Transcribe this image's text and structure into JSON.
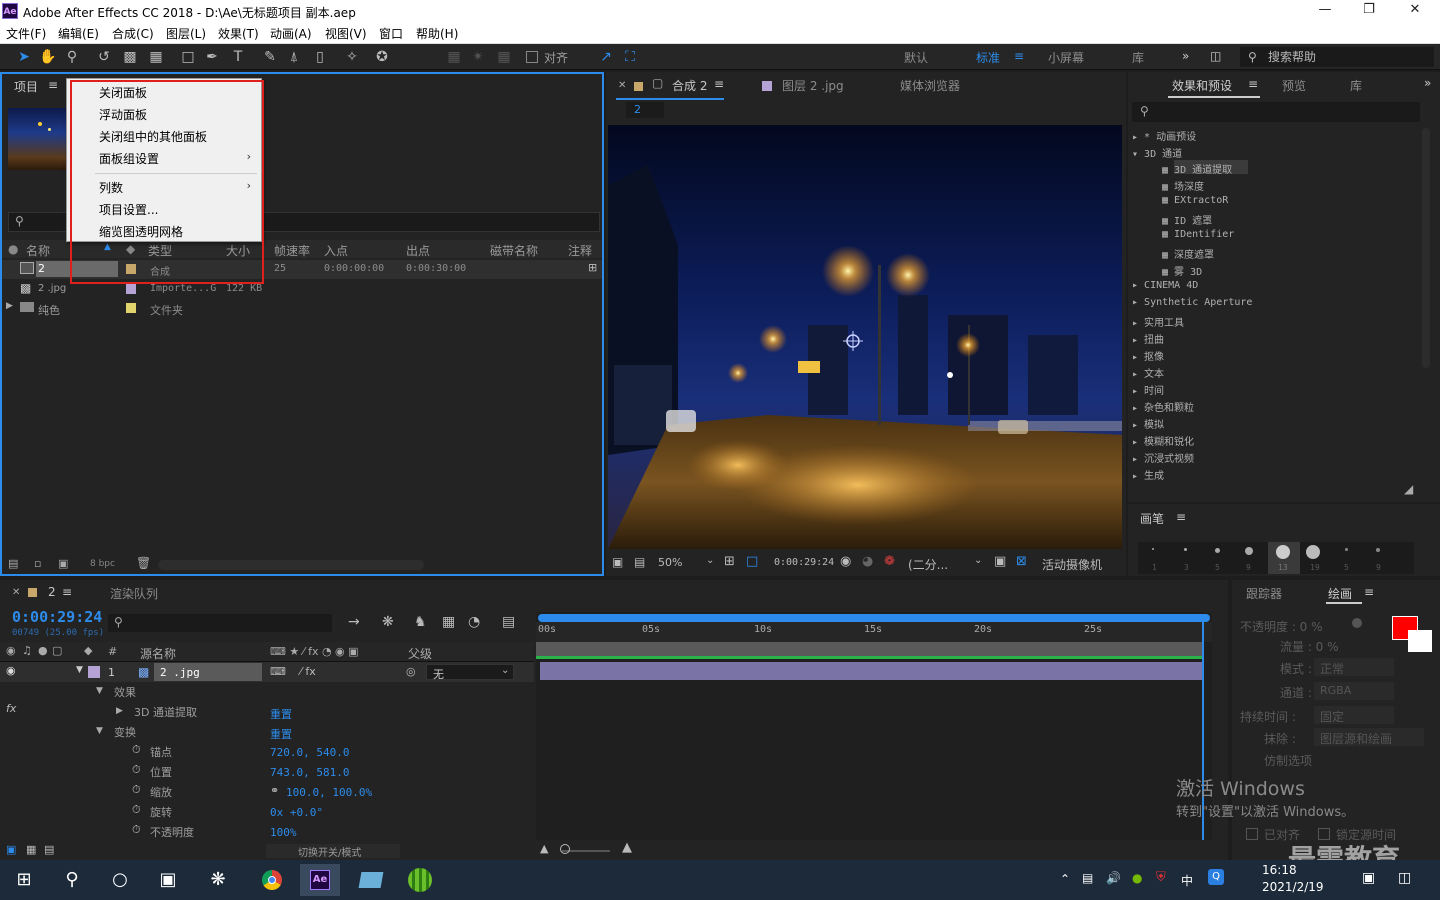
{
  "window": {
    "title": "Adobe After Effects CC 2018 - D:\\Ae\\无标题项目 副本.aep",
    "logo": "Ae"
  },
  "menubar": [
    "文件(F)",
    "编辑(E)",
    "合成(C)",
    "图层(L)",
    "效果(T)",
    "动画(A)",
    "视图(V)",
    "窗口",
    "帮助(H)"
  ],
  "toolbar": {
    "snap_label": "对齐",
    "workspaces": [
      "默认",
      "标准",
      "小屏幕",
      "库"
    ],
    "active_workspace": "标准",
    "search_placeholder": "搜索帮助"
  },
  "project_panel": {
    "tab": "项目",
    "columns": [
      "名称",
      "类型",
      "大小",
      "帧速率",
      "入点",
      "出点",
      "磁带名称",
      "注释"
    ],
    "rows": [
      {
        "name": "2",
        "type": "合成",
        "size": "",
        "fps": "25",
        "in": "0:00:00:00",
        "out": "0:00:30:00"
      },
      {
        "name": "2 .jpg",
        "type": "Importe...G",
        "size": "122 KB",
        "fps": "",
        "in": "",
        "out": ""
      },
      {
        "name": "纯色",
        "type": "文件夹",
        "size": "",
        "fps": "",
        "in": "",
        "out": ""
      }
    ],
    "bpc": "8 bpc"
  },
  "context_menu": {
    "items": [
      "关闭面板",
      "浮动面板",
      "关闭组中的其他面板",
      "面板组设置",
      "列数",
      "项目设置...",
      "缩览图透明网格"
    ],
    "submenu_arrow": "›"
  },
  "comp_panel": {
    "tabs": [
      "合成 2",
      "图层 2 .jpg",
      "媒体浏览器"
    ],
    "comp_name": "2",
    "zoom": "50%",
    "timecode": "0:00:29:24",
    "resolution": "(二分...",
    "camera": "活动摄像机"
  },
  "effects_panel": {
    "tabs": [
      "效果和预设",
      "预览",
      "库"
    ],
    "categories_top": [
      "* 动画预设",
      "3D 通道"
    ],
    "sub_items": [
      "3D 通道提取",
      "场深度",
      "EXtractoR",
      "ID 遮罩",
      "IDentifier",
      "深度遮罩",
      "雾 3D"
    ],
    "categories": [
      "CINEMA 4D",
      "Synthetic Aperture",
      "实用工具",
      "扭曲",
      "抠像",
      "文本",
      "时间",
      "杂色和颗粒",
      "模拟",
      "模糊和锐化",
      "沉浸式视频",
      "生成"
    ]
  },
  "brushes_panel": {
    "tab": "画笔",
    "sizes": [
      "1",
      "3",
      "5",
      "9",
      "13",
      "19",
      "5",
      "9"
    ]
  },
  "timeline": {
    "tabs": [
      "2",
      "渲染队列"
    ],
    "timecode": "0:00:29:24",
    "frames": "00749 (25.00 fps)",
    "col_source": "源名称",
    "col_parent": "父级",
    "layer_num": "1",
    "layer_name": "2 .jpg",
    "parent_value": "无",
    "ruler": [
      "00s",
      "05s",
      "10s",
      "15s",
      "20s",
      "25s"
    ],
    "props": [
      {
        "label": "效果",
        "value": ""
      },
      {
        "label": "3D 通道提取",
        "value": "重置"
      },
      {
        "label": "变换",
        "value": "重置"
      },
      {
        "label": "锚点",
        "value": "720.0, 540.0"
      },
      {
        "label": "位置",
        "value": "743.0, 581.0"
      },
      {
        "label": "缩放",
        "value": "100.0, 100.0%"
      },
      {
        "label": "旋转",
        "value": "0x +0.0°"
      },
      {
        "label": "不透明度",
        "value": "100%"
      }
    ],
    "footer": "切换开关/模式"
  },
  "paint_panel": {
    "tabs": [
      "跟踪器",
      "绘画"
    ],
    "opacity": "不透明度 :  0 %",
    "flow": "流量 :  0 %",
    "mode_label": "模式 :",
    "mode_value": "正常",
    "channel_label": "通道 :",
    "channel_value": "RGBA",
    "duration_label": "持续时间 :",
    "duration_value": "固定",
    "erase_label": "抹除 :",
    "erase_value": "图层源和绘画",
    "clone_label": "仿制选项",
    "aligned": "已对齐",
    "lock_time": "锁定源时间",
    "fg_color": "#ff0000",
    "bg_color": "#ffffff"
  },
  "watermark": {
    "line1": "激活 Windows",
    "line2": "转到\"设置\"以激活 Windows。",
    "brand": "最需教育"
  },
  "taskbar": {
    "time": "16:18",
    "date": "2021/2/19",
    "ime": "中"
  }
}
